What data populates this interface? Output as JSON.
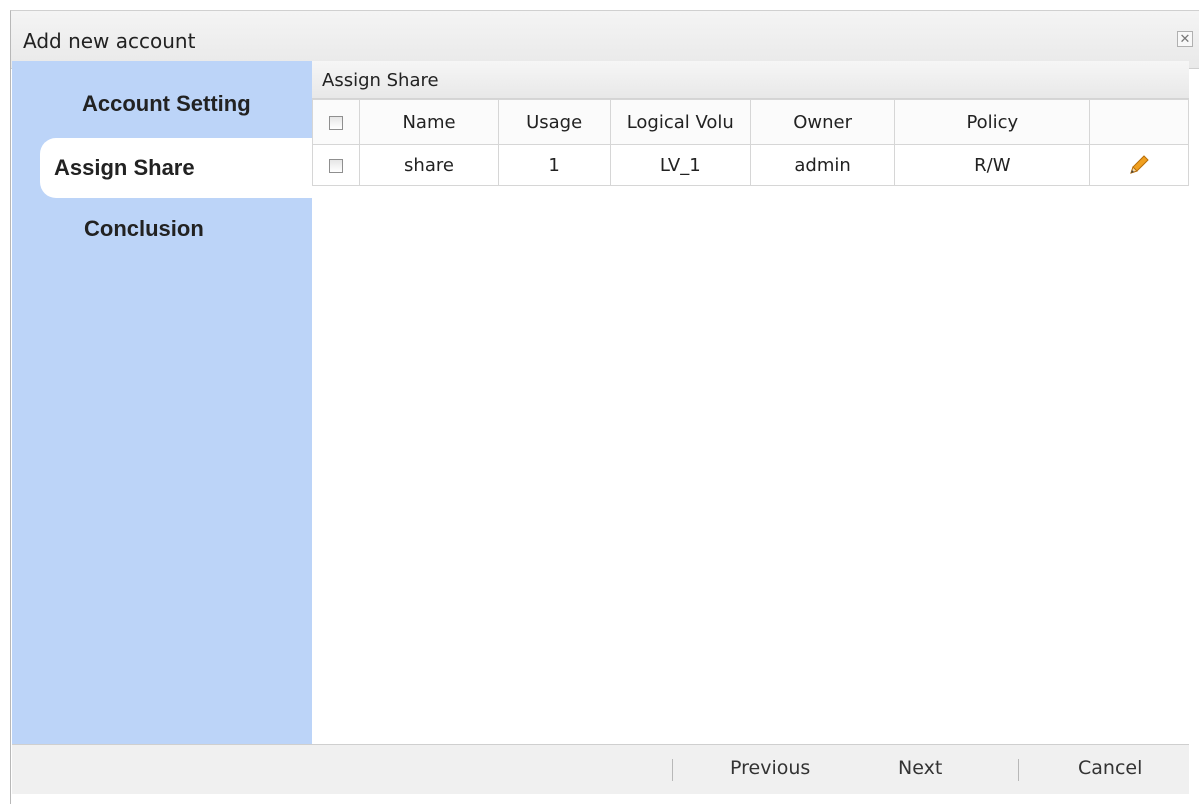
{
  "dialog": {
    "title": "Add new account",
    "close_glyph": "✕"
  },
  "sidebar": {
    "items": [
      {
        "label": "Account Setting",
        "active": false
      },
      {
        "label": "Assign Share",
        "active": true
      },
      {
        "label": "Conclusion",
        "active": false
      }
    ]
  },
  "panel": {
    "title": "Assign Share",
    "columns": [
      "Name",
      "Usage",
      "Logical Volu",
      "Owner",
      "Policy"
    ],
    "rows": [
      {
        "name": "share",
        "usage": "1",
        "logical_volume": "LV_1",
        "owner": "admin",
        "policy": "R/W",
        "edit_icon": "pencil-icon"
      }
    ]
  },
  "footer": {
    "previous": "Previous",
    "next": "Next",
    "cancel": "Cancel"
  },
  "colors": {
    "sidebar_bg": "#bcd4f8",
    "pencil": "#f0a020"
  }
}
